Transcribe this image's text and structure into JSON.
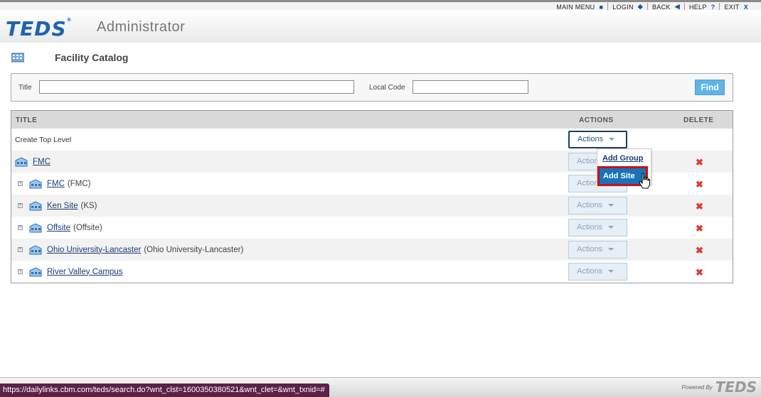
{
  "nav": {
    "main_menu": "MAIN MENU",
    "login": "LOGIN",
    "back": "BACK",
    "help": "HELP",
    "help_icon": "?",
    "exit": "EXIT",
    "exit_icon": "X"
  },
  "header": {
    "logo": "TEDS",
    "logo_mark": "®",
    "app_name": "Administrator"
  },
  "page": {
    "title": "Facility Catalog"
  },
  "search": {
    "title_label": "Title",
    "title_value": "",
    "local_code_label": "Local Code",
    "local_code_value": "",
    "find_label": "Find"
  },
  "table": {
    "columns": {
      "title": "TITLE",
      "actions": "ACTIONS",
      "delete": "DELETE"
    },
    "top_level": {
      "label": "Create Top Level",
      "actions_label": "Actions"
    },
    "rows": [
      {
        "name": "FMC",
        "code": "",
        "actions_label": "Actions"
      },
      {
        "name": "FMC",
        "code": "(FMC)",
        "actions_label": "Actions"
      },
      {
        "name": "Ken Site",
        "code": "(KS)",
        "actions_label": "Actions"
      },
      {
        "name": "Offsite",
        "code": "(Offsite)",
        "actions_label": "Actions"
      },
      {
        "name": "Ohio University-Lancaster",
        "code": "(Ohio University-Lancaster)",
        "actions_label": "Actions"
      },
      {
        "name": "River Valley Campus",
        "code": "",
        "actions_label": "Actions"
      }
    ]
  },
  "actions_menu": {
    "items": [
      "Add Group",
      "Add Site"
    ],
    "selected": "Add Site"
  },
  "footer": {
    "powered_by": "Powered By",
    "logo": "TEDS",
    "status_url": "https://dailylinks.cbm.com/teds/search.do?wnt_clst=1600350380521&wnt_clet=&wnt_txnid=#"
  },
  "colors": {
    "brand_blue": "#1f63b0",
    "find_button": "#5fb3e6",
    "menu_selected": "#1874b8",
    "highlight_border": "#c4121a",
    "delete": "#e03a2f"
  }
}
